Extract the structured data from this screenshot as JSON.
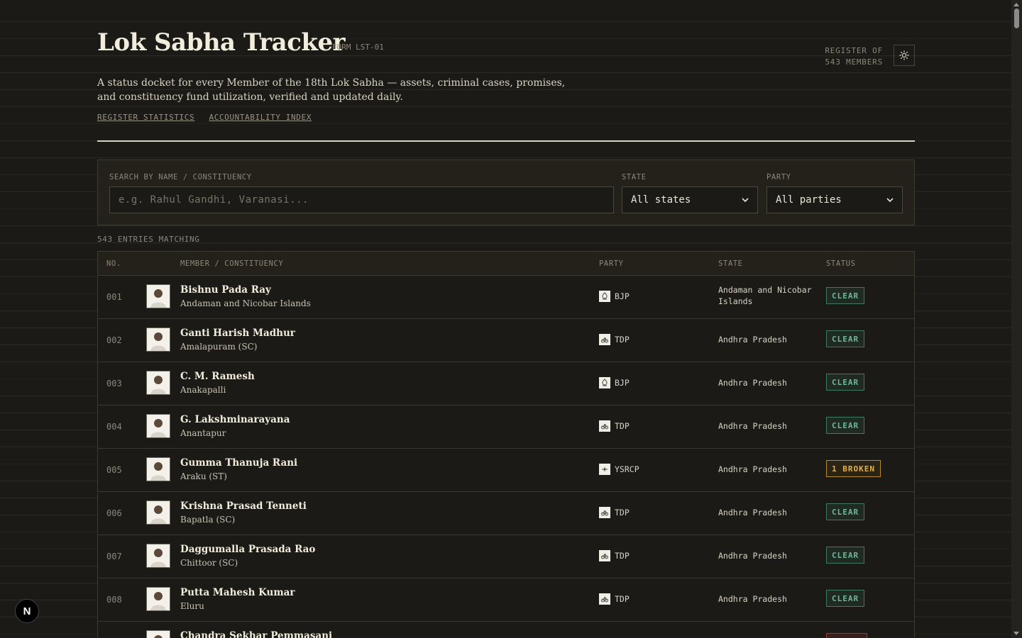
{
  "header": {
    "title": "Lok Sabha Tracker",
    "form_code": "FORM LST-01",
    "register_line1": "REGISTER OF",
    "register_line2": "543 MEMBERS",
    "theme_icon": "sun-icon",
    "subtitle": "A status docket for every Member of the 18th Lok Sabha — assets, criminal cases, promises, and constituency fund utilization, verified and updated daily.",
    "links": [
      "REGISTER STATISTICS",
      "ACCOUNTABILITY INDEX"
    ]
  },
  "filters": {
    "search_label": "SEARCH BY NAME / CONSTITUENCY",
    "search_placeholder": "e.g. Rahul Gandhi, Varanasi...",
    "state_label": "STATE",
    "state_value": "All states",
    "party_label": "PARTY",
    "party_value": "All parties"
  },
  "entries_count": "543 ENTRIES MATCHING",
  "table": {
    "headers": [
      "NO.",
      "MEMBER / CONSTITUENCY",
      "PARTY",
      "STATE",
      "STATUS"
    ],
    "rows": [
      {
        "no": "001",
        "name": "Bishnu Pada Ray",
        "constituency": "Andaman and Nicobar Islands",
        "party": "BJP",
        "state": "Andaman and Nicobar Islands",
        "status": "CLEAR",
        "status_type": "clear"
      },
      {
        "no": "002",
        "name": "Ganti Harish Madhur",
        "constituency": "Amalapuram (SC)",
        "party": "TDP",
        "state": "Andhra Pradesh",
        "status": "CLEAR",
        "status_type": "clear"
      },
      {
        "no": "003",
        "name": "C. M. Ramesh",
        "constituency": "Anakapalli",
        "party": "BJP",
        "state": "Andhra Pradesh",
        "status": "CLEAR",
        "status_type": "clear"
      },
      {
        "no": "004",
        "name": "G. Lakshminarayana",
        "constituency": "Anantapur",
        "party": "TDP",
        "state": "Andhra Pradesh",
        "status": "CLEAR",
        "status_type": "clear"
      },
      {
        "no": "005",
        "name": "Gumma Thanuja Rani",
        "constituency": "Araku (ST)",
        "party": "YSRCP",
        "state": "Andhra Pradesh",
        "status": "1 BROKEN",
        "status_type": "broken"
      },
      {
        "no": "006",
        "name": "Krishna Prasad Tenneti",
        "constituency": "Bapatla (SC)",
        "party": "TDP",
        "state": "Andhra Pradesh",
        "status": "CLEAR",
        "status_type": "clear"
      },
      {
        "no": "007",
        "name": "Daggumalla Prasada Rao",
        "constituency": "Chittoor (SC)",
        "party": "TDP",
        "state": "Andhra Pradesh",
        "status": "CLEAR",
        "status_type": "clear"
      },
      {
        "no": "008",
        "name": "Putta Mahesh Kumar",
        "constituency": "Eluru",
        "party": "TDP",
        "state": "Andhra Pradesh",
        "status": "CLEAR",
        "status_type": "clear"
      },
      {
        "no": "009",
        "name": "Chandra Sekhar Pemmasani",
        "constituency": "",
        "party": "",
        "state": "",
        "status": "",
        "status_type": "red"
      }
    ]
  },
  "colors": {
    "background": "#1b1a17",
    "clear": "#6fb894",
    "broken": "#e0b04a"
  },
  "dev_badge": "N"
}
